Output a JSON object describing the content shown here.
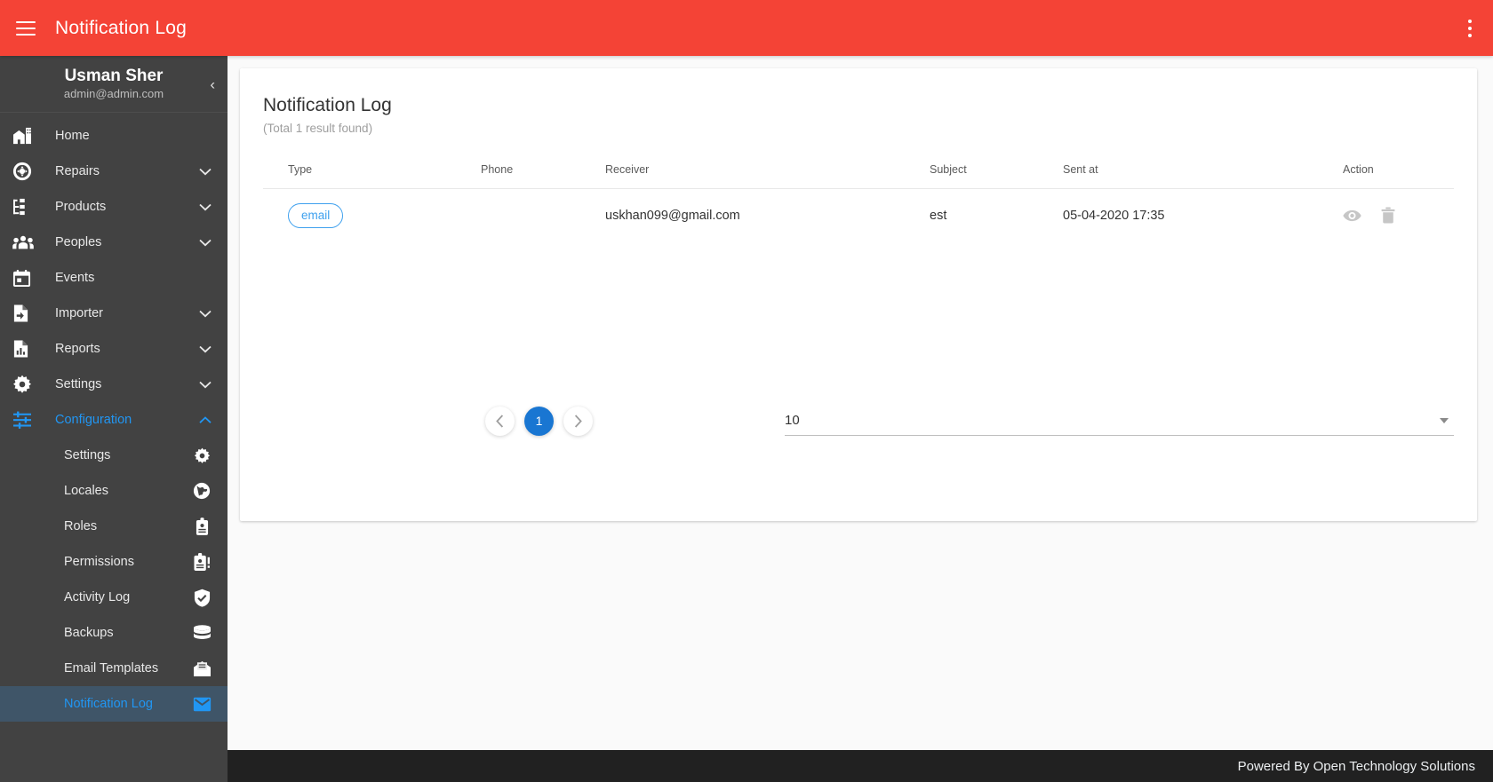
{
  "topbar": {
    "title": "Notification Log",
    "menu_icon": "hamburger-icon",
    "overflow_icon": "more-vertical-icon"
  },
  "sidebar": {
    "profile": {
      "name": "Usman Sher",
      "email": "admin@admin.com",
      "collapse_glyph": "‹"
    },
    "items": [
      {
        "label": "Home",
        "icon": "home-icon",
        "expandable": false
      },
      {
        "label": "Repairs",
        "icon": "lifebuoy-icon",
        "expandable": true,
        "chevron": "∨"
      },
      {
        "label": "Products",
        "icon": "sitemap-icon",
        "expandable": true,
        "chevron": "∨"
      },
      {
        "label": "Peoples",
        "icon": "people-icon",
        "expandable": true,
        "chevron": "∨"
      },
      {
        "label": "Events",
        "icon": "calendar-icon",
        "expandable": false
      },
      {
        "label": "Importer",
        "icon": "file-import-icon",
        "expandable": true,
        "chevron": "∨"
      },
      {
        "label": "Reports",
        "icon": "chart-file-icon",
        "expandable": true,
        "chevron": "∨"
      },
      {
        "label": "Settings",
        "icon": "gear-icon",
        "expandable": true,
        "chevron": "∨"
      },
      {
        "label": "Configuration",
        "icon": "sliders-icon",
        "expandable": true,
        "chevron": "∧",
        "active": true
      }
    ],
    "sub_items": [
      {
        "label": "Settings",
        "icon": "gear-icon"
      },
      {
        "label": "Locales",
        "icon": "globe-icon"
      },
      {
        "label": "Roles",
        "icon": "id-badge-icon"
      },
      {
        "label": "Permissions",
        "icon": "id-badge-alert-icon"
      },
      {
        "label": "Activity Log",
        "icon": "shield-check-icon"
      },
      {
        "label": "Backups",
        "icon": "database-icon"
      },
      {
        "label": "Email Templates",
        "icon": "mail-open-icon"
      },
      {
        "label": "Notification Log",
        "icon": "envelope-icon",
        "selected": true
      }
    ]
  },
  "main": {
    "title": "Notification Log",
    "subtitle": "(Total 1 result found)",
    "table": {
      "headers": [
        "Type",
        "Phone",
        "Receiver",
        "Subject",
        "Sent at",
        "Action"
      ],
      "rows": [
        {
          "type": "email",
          "phone": "",
          "receiver": "uskhan099@gmail.com",
          "subject": "est",
          "sent_at": "05-04-2020 17:35",
          "actions": [
            "eye-icon",
            "trash-icon"
          ]
        }
      ]
    },
    "pagination": {
      "prev_glyph": "‹",
      "next_glyph": "›",
      "current_page": "1"
    },
    "per_page": {
      "value": "10",
      "caret_icon": "chevron-down-icon"
    }
  },
  "footer": {
    "text": "Powered By Open Technology Solutions"
  },
  "colors": {
    "brand_red": "#f44336",
    "accent_blue": "#2196f3",
    "pager_blue": "#1976d2",
    "sidebar_bg": "#424242",
    "sidebar_active_bg": "#3f5568",
    "footer_bg": "#212121"
  }
}
